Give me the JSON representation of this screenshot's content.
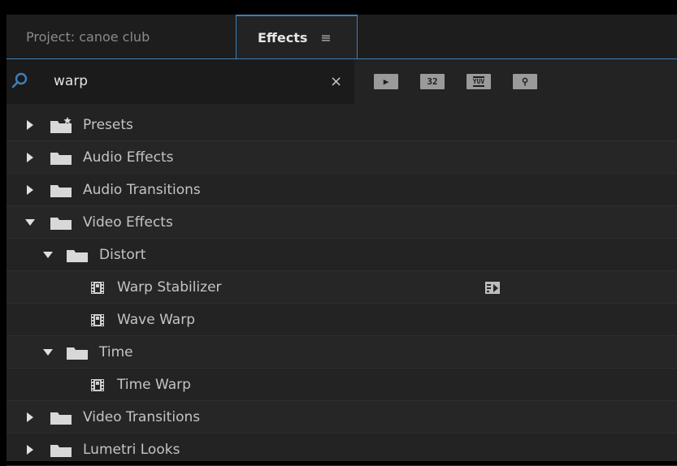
{
  "tabs": {
    "project": "Project: canoe club",
    "effects": "Effects",
    "menu_glyph": "≡"
  },
  "search": {
    "value": "warp",
    "clear_glyph": "×"
  },
  "filters": {
    "accelerated": "▶",
    "bit32": "32",
    "yuv": "YUV",
    "gpu": "⚲"
  },
  "tree": {
    "presets": "Presets",
    "audio_effects": "Audio Effects",
    "audio_transitions": "Audio Transitions",
    "video_effects": "Video Effects",
    "distort": "Distort",
    "warp_stabilizer": "Warp Stabilizer",
    "wave_warp": "Wave Warp",
    "time": "Time",
    "time_warp": "Time Warp",
    "video_transitions": "Video Transitions",
    "lumetri_looks": "Lumetri Looks"
  },
  "icons": {
    "search": "search-icon",
    "clear": "close-icon",
    "folder": "folder-icon",
    "preset_folder": "preset-folder-icon",
    "effect": "film-effect-icon",
    "accelerated": "accelerated-effects-icon",
    "bit32": "32-bit-icon",
    "yuv": "yuv-icon",
    "gpu": "gpu-icon"
  },
  "colors": {
    "accent": "#3f7fb8",
    "panel_bg": "#232323",
    "text": "#c4c4c4"
  }
}
